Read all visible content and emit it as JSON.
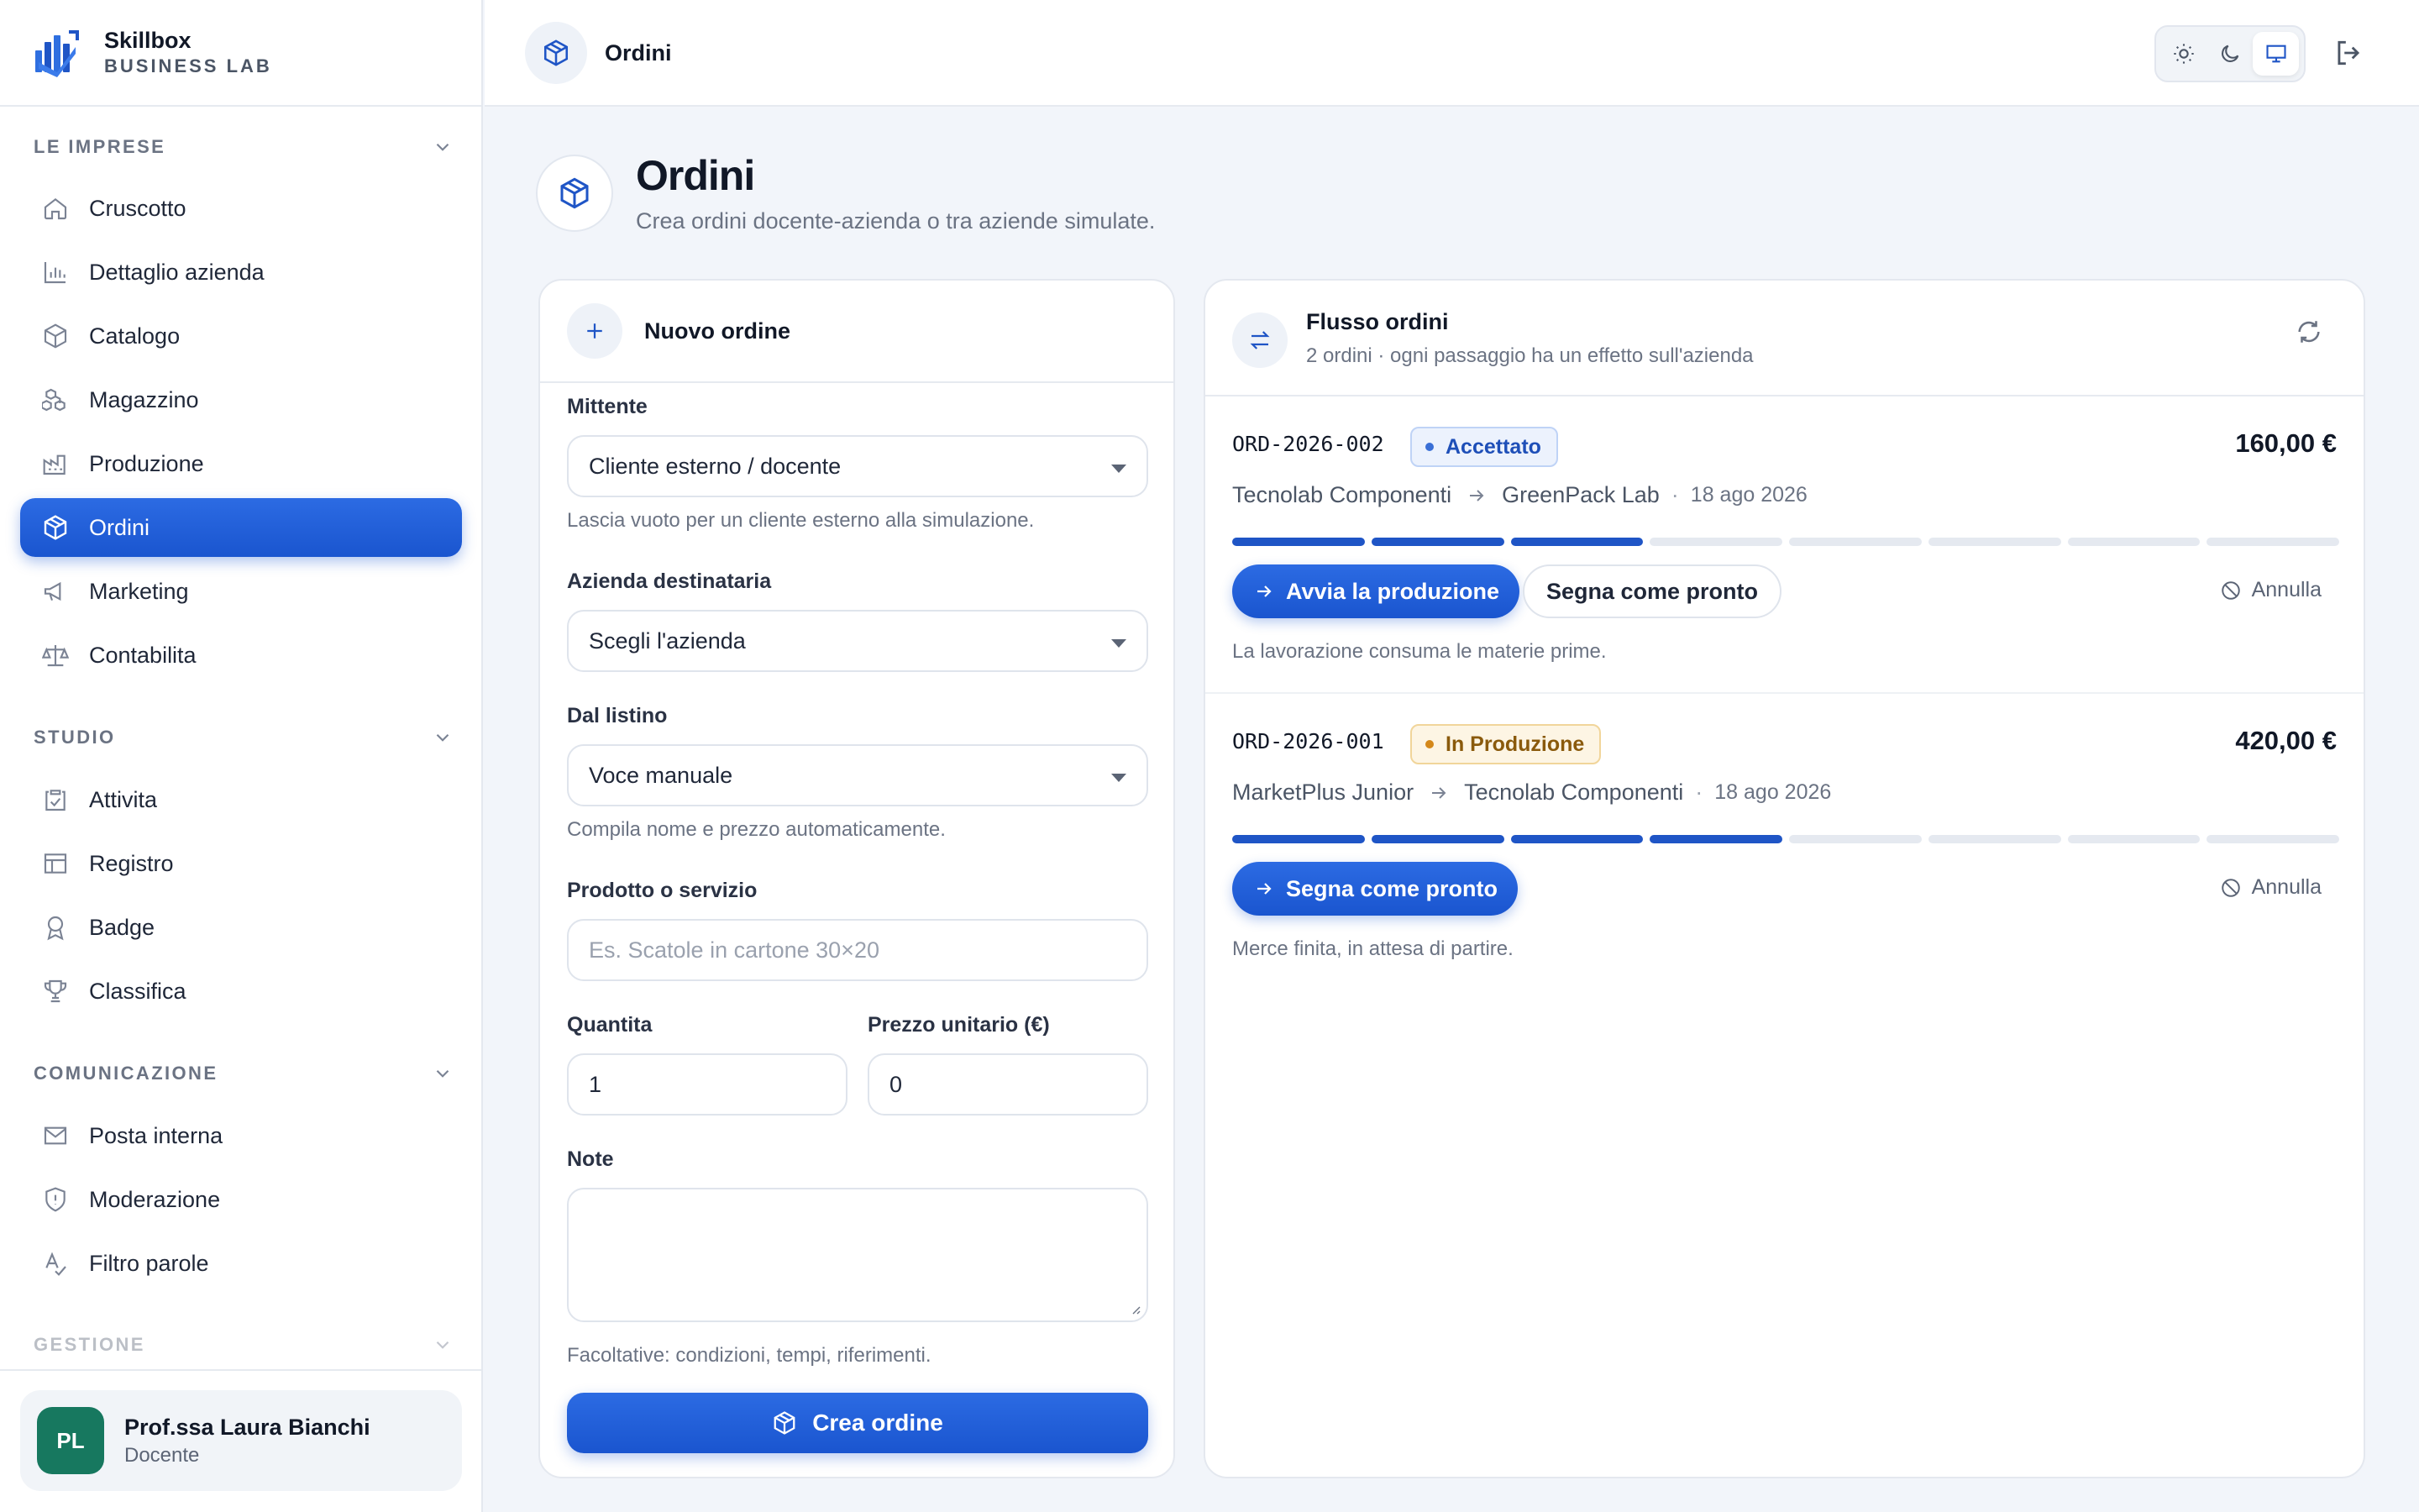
{
  "brand": {
    "name": "Skillbox",
    "subtitle": "BUSINESS LAB"
  },
  "sidebar": {
    "sections": [
      {
        "title": "LE IMPRESE",
        "items": [
          "Cruscotto",
          "Dettaglio azienda",
          "Catalogo",
          "Magazzino",
          "Produzione",
          "Ordini",
          "Marketing",
          "Contabilita"
        ]
      },
      {
        "title": "STUDIO",
        "items": [
          "Attivita",
          "Registro",
          "Badge",
          "Classifica"
        ]
      },
      {
        "title": "COMUNICAZIONE",
        "items": [
          "Posta interna",
          "Moderazione",
          "Filtro parole"
        ]
      },
      {
        "title": "GESTIONE",
        "items": []
      }
    ],
    "active_item": "Ordini"
  },
  "user": {
    "initials": "PL",
    "name": "Prof.ssa Laura Bianchi",
    "role": "Docente"
  },
  "topbar": {
    "title": "Ordini",
    "theme_selected": "system"
  },
  "page": {
    "title": "Ordini",
    "subtitle": "Crea ordini docente-azienda o tra aziende simulate."
  },
  "new_order": {
    "title": "Nuovo ordine",
    "sender": {
      "label": "Mittente",
      "value": "Cliente esterno / docente",
      "hint": "Lascia vuoto per un cliente esterno alla simulazione."
    },
    "recipient": {
      "label": "Azienda destinataria",
      "value": "Scegli l'azienda"
    },
    "price_list": {
      "label": "Dal listino",
      "value": "Voce manuale",
      "hint": "Compila nome e prezzo automaticamente."
    },
    "product": {
      "label": "Prodotto o servizio",
      "placeholder": "Es. Scatole in cartone 30×20"
    },
    "quantity": {
      "label": "Quantita",
      "value": "1"
    },
    "unit_price": {
      "label": "Prezzo unitario (€)",
      "value": "0"
    },
    "notes": {
      "label": "Note",
      "hint": "Facoltative: condizioni, tempi, riferimenti."
    },
    "submit_label": "Crea ordine"
  },
  "order_flow": {
    "title": "Flusso ordini",
    "subtitle": "2 ordini · ogni passaggio ha un effetto sull'azienda",
    "orders": [
      {
        "id": "ORD-2026-002",
        "status": "Accettato",
        "status_color": "#1e4fb8",
        "amount": "160,00 €",
        "from": "Tecnolab Componenti",
        "to": "GreenPack Lab",
        "date": "18 ago 2026",
        "progress_steps_done": 3,
        "progress_steps_total": 8,
        "primary_action": "Avvia la produzione",
        "secondary_action": "Segna come pronto",
        "cancel_label": "Annulla",
        "note": "La lavorazione consuma le materie prime."
      },
      {
        "id": "ORD-2026-001",
        "status": "In Produzione",
        "status_color": "#8a5a0c",
        "amount": "420,00 €",
        "from": "MarketPlus Junior",
        "to": "Tecnolab Componenti",
        "date": "18 ago 2026",
        "progress_steps_done": 4,
        "progress_steps_total": 8,
        "primary_action": "Segna come pronto",
        "cancel_label": "Annulla",
        "note": "Merce finita, in attesa di partire."
      }
    ]
  },
  "colors": {
    "accent": "#1f55c6",
    "avatar": "#17785f"
  }
}
